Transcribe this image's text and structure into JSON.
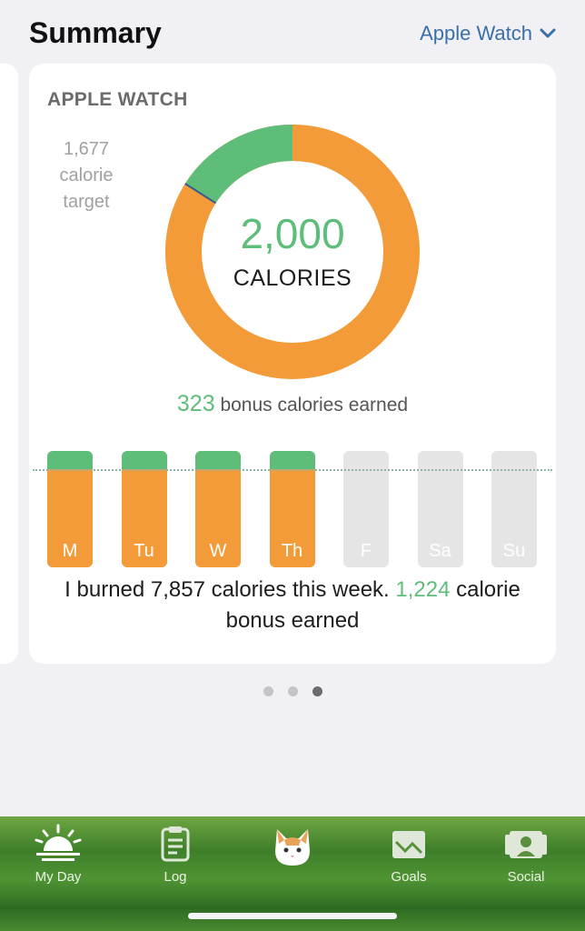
{
  "header": {
    "title": "Summary",
    "device": "Apple Watch"
  },
  "card": {
    "title": "APPLE WATCH",
    "target_number": "1,677",
    "target_word1": "calorie",
    "target_word2": "target",
    "donut_value": "2,000",
    "donut_unit": "CALORIES",
    "bonus_value": "323",
    "bonus_text": " bonus calories earned",
    "week_text": "I burned 7,857 calories this week. ",
    "week_bonus_value": "1,224",
    "week_bonus_text": " calorie bonus earned",
    "colors": {
      "burned": "#f29b38",
      "bonus": "#5fbd7a",
      "empty": "#e5e5e5"
    },
    "donut_fraction_bonus": 0.16
  },
  "chart_data": {
    "type": "bar",
    "categories": [
      "M",
      "Tu",
      "W",
      "Th",
      "F",
      "Sa",
      "Su"
    ],
    "series": [
      {
        "values": [
          1,
          1,
          1,
          1,
          0,
          0,
          0
        ]
      }
    ]
  },
  "pager": {
    "count": 3,
    "active": 2
  },
  "tabbar": {
    "items": [
      {
        "label": "My Day",
        "icon": "sunrise-icon"
      },
      {
        "label": "Log",
        "icon": "clipboard-icon"
      },
      {
        "label": "",
        "icon": "cat-avatar-icon"
      },
      {
        "label": "Goals",
        "icon": "goals-chart-icon"
      },
      {
        "label": "Social",
        "icon": "social-people-icon"
      }
    ]
  }
}
